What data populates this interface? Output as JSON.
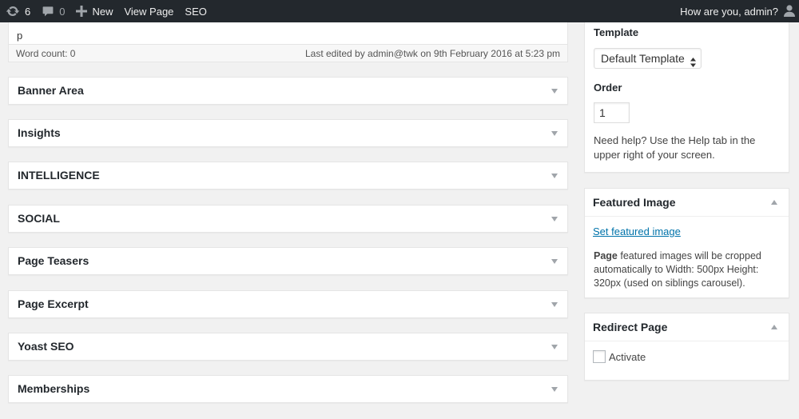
{
  "adminbar": {
    "updates_count": "6",
    "comments_count": "0",
    "new_label": "New",
    "view_page_label": "View Page",
    "seo_label": "SEO",
    "greeting": "How are you, admin?"
  },
  "editor": {
    "content_text": "p",
    "word_count": "Word count: 0",
    "last_edited": "Last edited by admin@twk on 9th February 2016 at 5:23 pm"
  },
  "metaboxes": [
    {
      "title": "Banner Area"
    },
    {
      "title": "Insights"
    },
    {
      "title": "INTELLIGENCE"
    },
    {
      "title": "SOCIAL"
    },
    {
      "title": "Page Teasers"
    },
    {
      "title": "Page Excerpt"
    },
    {
      "title": "Yoast SEO"
    },
    {
      "title": "Memberships"
    }
  ],
  "page_attributes": {
    "template_label": "Template",
    "template_value": "Default Template",
    "order_label": "Order",
    "order_value": "1",
    "help_text": "Need help? Use the Help tab in the upper right of your screen."
  },
  "featured_image": {
    "title": "Featured Image",
    "set_link": "Set featured image",
    "note_bold": "Page",
    "note_rest": " featured images will be cropped automatically to Width: 500px Height: 320px (used on siblings carousel)."
  },
  "redirect_page": {
    "title": "Redirect Page",
    "activate_label": "Activate"
  },
  "colors": {
    "adminbar_bg": "#23282d",
    "link": "#0073aa",
    "background": "#f1f1f1"
  },
  "icons": [
    "updates-icon",
    "comments-icon",
    "plus-icon",
    "user-avatar-icon",
    "toggle-down-icon",
    "toggle-up-icon",
    "select-arrows-icon"
  ]
}
